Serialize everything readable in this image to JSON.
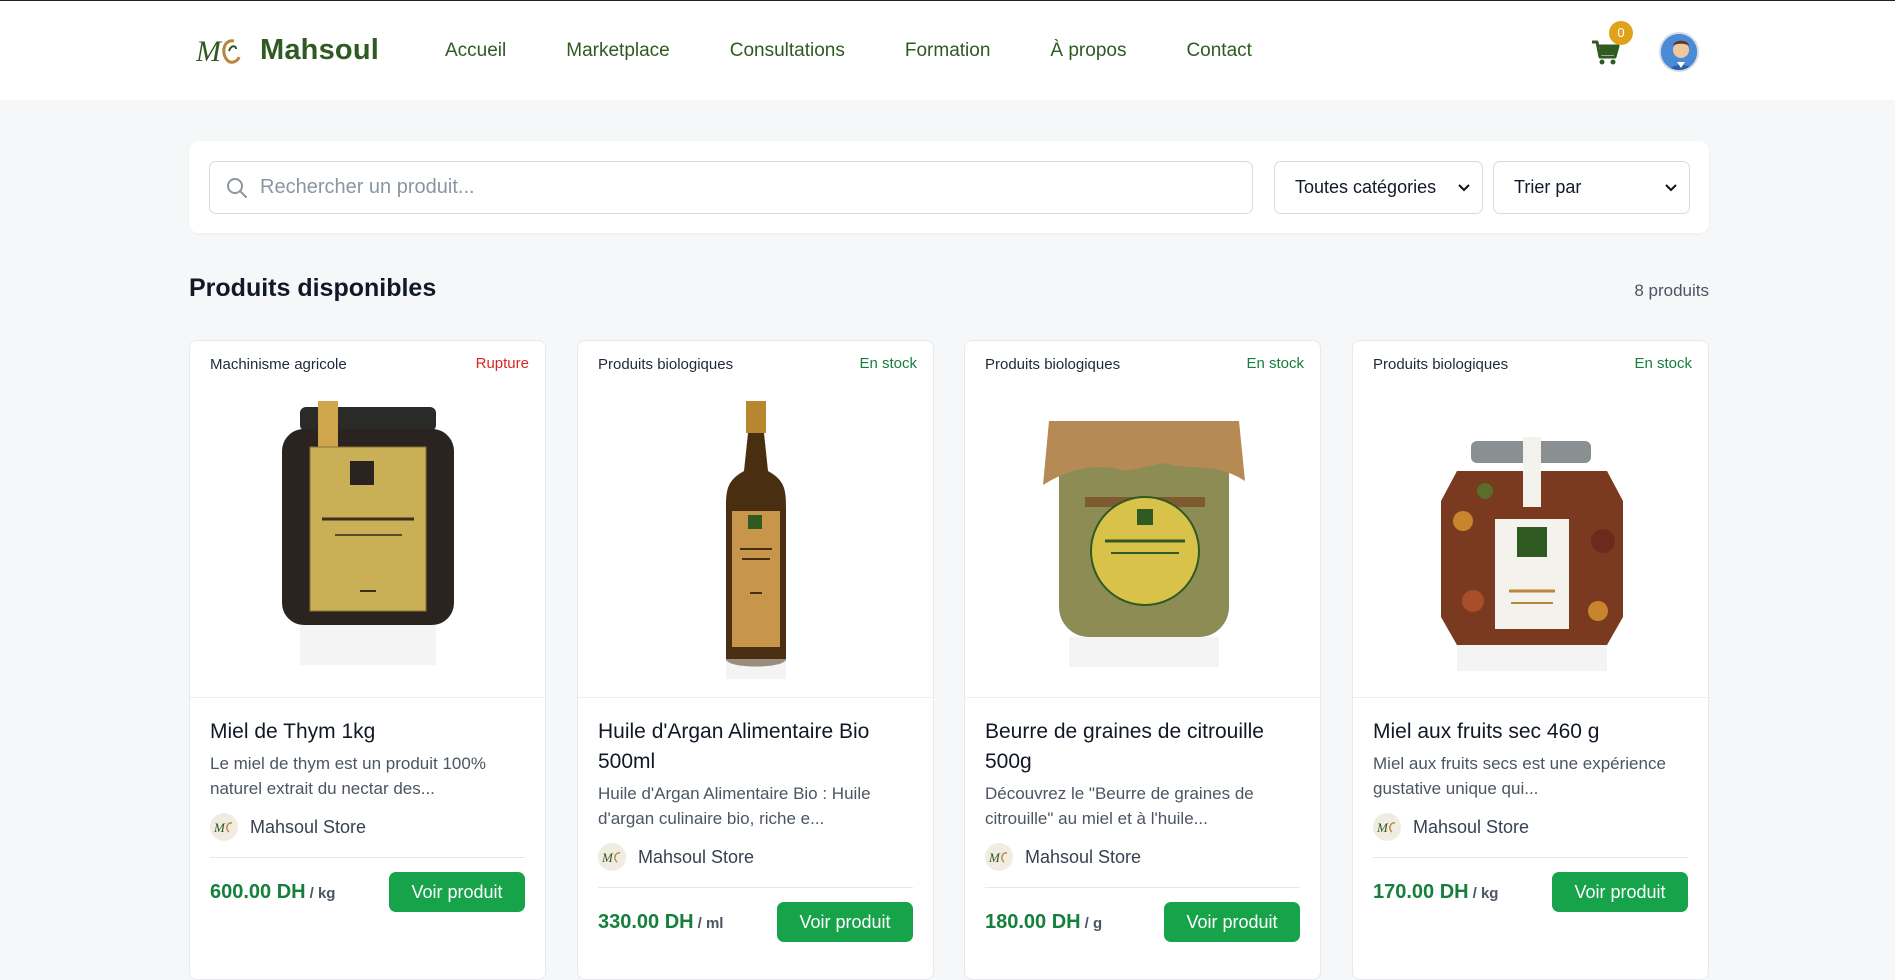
{
  "brand": {
    "name": "Mahsoul"
  },
  "nav": [
    {
      "label": "Accueil"
    },
    {
      "label": "Marketplace"
    },
    {
      "label": "Consultations"
    },
    {
      "label": "Formation"
    },
    {
      "label": "À propos"
    },
    {
      "label": "Contact"
    }
  ],
  "cart": {
    "count": "0",
    "icon": "cart-icon"
  },
  "search": {
    "placeholder": "Rechercher un produit...",
    "value": ""
  },
  "filters": {
    "category": "Toutes catégories",
    "sort": "Trier par"
  },
  "section": {
    "title": "Produits disponibles",
    "count": "8 produits"
  },
  "colors": {
    "brand": "#2f5a22",
    "accent": "#16a34a",
    "out_of_stock": "#dc2626",
    "badge": "#e0a11b"
  },
  "products": [
    {
      "category": "Machinisme agricole",
      "stock": "Rupture",
      "title": "Miel de Thym 1kg",
      "description": "Le miel de thym est un produit 100% naturel extrait du nectar des...",
      "seller": "Mahsoul Store",
      "price": "600.00 DH",
      "unit": "/ kg",
      "button": "Voir produit"
    },
    {
      "category": "Produits biologiques",
      "stock": "En stock",
      "title": "Huile d'Argan Alimentaire Bio 500ml",
      "description": "Huile d'Argan Alimentaire Bio : Huile d'argan culinaire bio, riche e...",
      "seller": "Mahsoul Store",
      "price": "330.00 DH",
      "unit": "/ ml",
      "button": "Voir produit"
    },
    {
      "category": "Produits biologiques",
      "stock": "En stock",
      "title": "Beurre de graines de citrouille 500g",
      "description": "Découvrez le \"Beurre de graines de citrouille\" au miel et à l'huile...",
      "seller": "Mahsoul Store",
      "price": "180.00 DH",
      "unit": "/ g",
      "button": "Voir produit"
    },
    {
      "category": "Produits biologiques",
      "stock": "En stock",
      "title": "Miel aux fruits sec 460 g",
      "description": "Miel aux fruits secs est une expérience gustative unique qui...",
      "seller": "Mahsoul Store",
      "price": "170.00 DH",
      "unit": "/ kg",
      "button": "Voir produit"
    }
  ]
}
